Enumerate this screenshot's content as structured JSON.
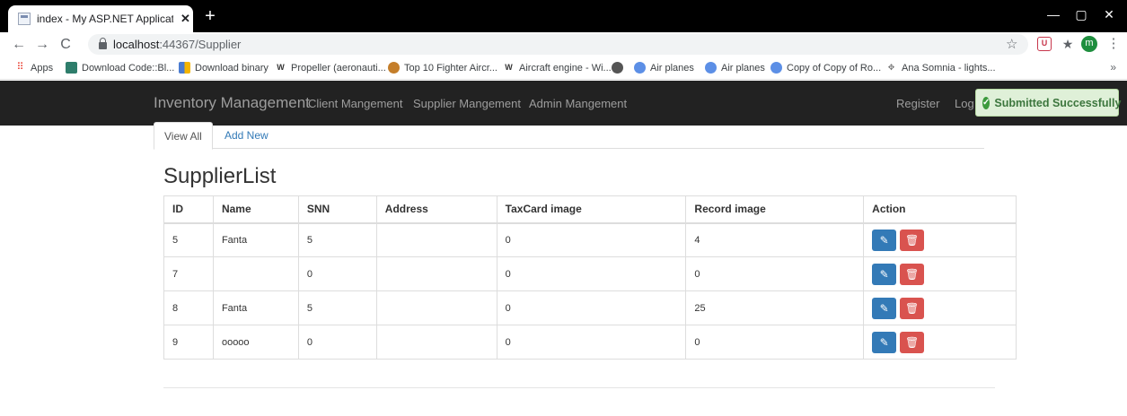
{
  "browser": {
    "tab_title": "index - My ASP.NET Application",
    "tab_close": "✕",
    "new_tab": "+",
    "url_host": "localhost",
    "url_path": ":44367/Supplier",
    "controls": {
      "back": "←",
      "forward": "→",
      "reload": "C",
      "star": "☆",
      "profile_initial": "m",
      "menu": "⋮",
      "minimize": "—",
      "maximize": "▢",
      "close": "✕",
      "ext_shield": "U",
      "ext_puzzle": "★"
    }
  },
  "bookmarks": [
    {
      "label": "Apps",
      "icon": "apps-grid-icon",
      "color": "#ea4335"
    },
    {
      "label": "Download Code::Bl...",
      "icon": "codeblocks-icon",
      "color": "#2e7d6b"
    },
    {
      "label": "Download binary",
      "icon": "binary-icon",
      "color": "#4a7bd0"
    },
    {
      "label": "Propeller (aeronauti...",
      "icon": "wikipedia-icon",
      "color": "#fff"
    },
    {
      "label": "Top 10 Fighter Aircr...",
      "icon": "site-icon",
      "color": "#c47e2a"
    },
    {
      "label": "Aircraft engine - Wi...",
      "icon": "wikipedia-icon",
      "color": "#fff"
    },
    {
      "label": "",
      "icon": "globe-icon",
      "color": "#555"
    },
    {
      "label": "Air planes",
      "icon": "globe-icon",
      "color": "#5c8fe6"
    },
    {
      "label": "Air planes",
      "icon": "globe-icon",
      "color": "#5c8fe6"
    },
    {
      "label": "Copy of Copy of Ro...",
      "icon": "globe-icon",
      "color": "#5c8fe6"
    },
    {
      "label": "Ana Somnia - lights...",
      "icon": "ana-somnia-icon",
      "color": "#777"
    }
  ],
  "bookmarks_more": "»",
  "navbar": {
    "brand": "Inventory Management",
    "links": [
      "Client Mangement",
      "Supplier Mangement",
      "Admin Mangement"
    ],
    "register": "Register",
    "login": "Log"
  },
  "toast": {
    "icon": "✓",
    "text": "Submitted Successfully",
    "color": "#3c763d"
  },
  "tabs": {
    "view_all": "View All",
    "add_new": "Add New"
  },
  "page_title": "SupplierList",
  "table": {
    "headers": [
      "ID",
      "Name",
      "SNN",
      "Address",
      "TaxCard image",
      "Record image",
      "Action"
    ],
    "rows": [
      [
        "5",
        "Fanta",
        "5",
        "",
        "0",
        "4"
      ],
      [
        "7",
        "",
        "0",
        "",
        "0",
        "0"
      ],
      [
        "8",
        "Fanta",
        "5",
        "",
        "0",
        "25"
      ],
      [
        "9",
        "ooooo",
        "0",
        "",
        "0",
        "0"
      ]
    ],
    "edit_icon": "✎",
    "delete_icon": "🗑"
  },
  "colors": {
    "navbar_bg": "#222222",
    "link": "#337ab7",
    "edit_btn": "#337ab7",
    "delete_btn": "#d9534f"
  }
}
